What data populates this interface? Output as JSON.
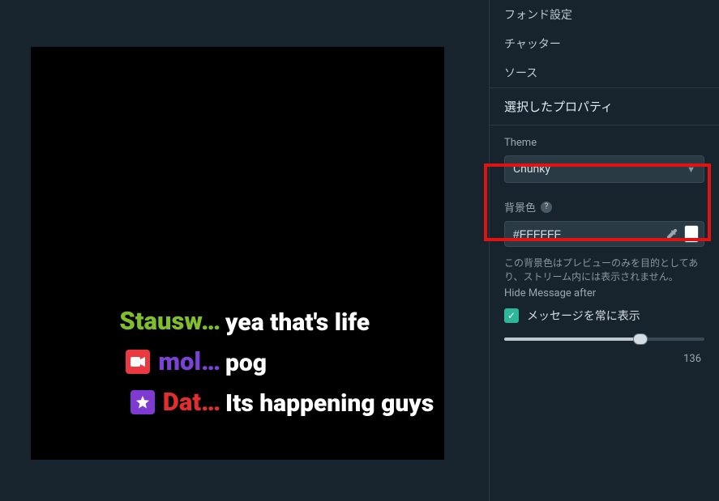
{
  "chat": [
    {
      "name": "Stausw…",
      "name_color": "#7fbf2b",
      "badge": null,
      "message": "yea that's life"
    },
    {
      "name": "mol…",
      "name_color": "#7a43d4",
      "badge": "cam",
      "message": "pog"
    },
    {
      "name": "Dat…",
      "name_color": "#e02d2d",
      "badge": "star",
      "message": "Its happening guys"
    }
  ],
  "nav": {
    "font_settings": "フォンド設定",
    "chatter": "チャッター",
    "source": "ソース"
  },
  "section_selected_props": "選択したプロパティ",
  "theme": {
    "label": "Theme",
    "value": "Chunky"
  },
  "bgcolor": {
    "label": "背景色",
    "value": "#FFFFFF",
    "swatch": "#ffffff"
  },
  "hint_line1": "この背景色はプレビューのみを目的としてあ",
  "hint_line2": "り、ストリーム内には表示されません。",
  "hide_after_label": "Hide Message after",
  "always_show_label": "メッセージを常に表示",
  "always_show_checked": true,
  "slider": {
    "value": 136,
    "min": 0,
    "max": 200
  }
}
